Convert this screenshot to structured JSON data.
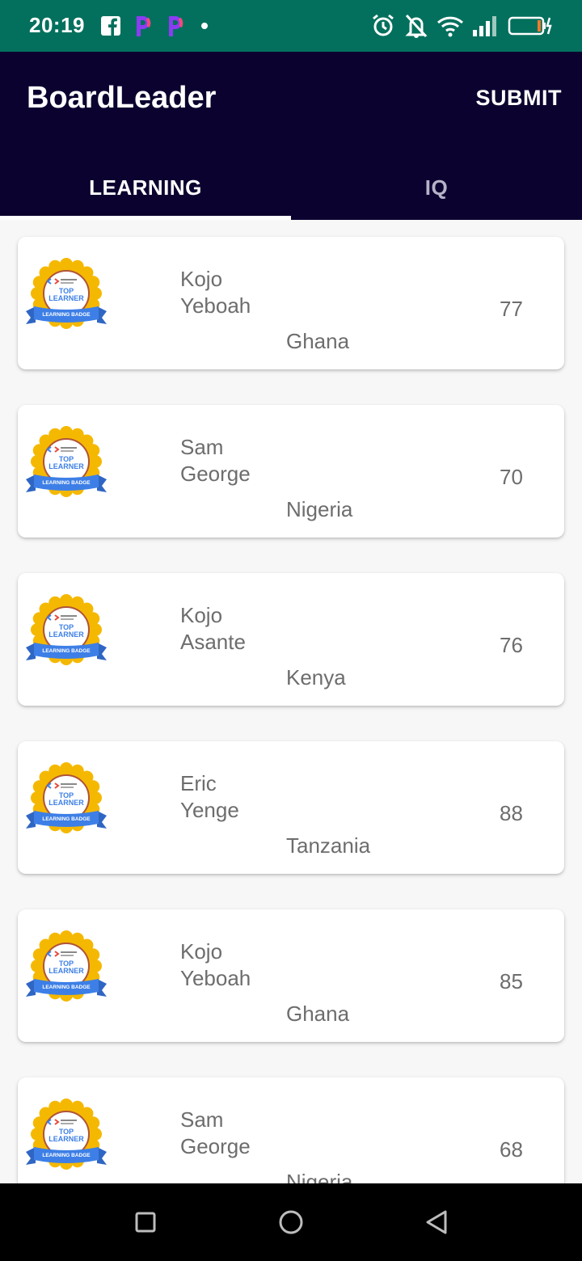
{
  "status_bar": {
    "time": "20:19"
  },
  "app_bar": {
    "title": "BoardLeader",
    "submit_label": "SUBMIT"
  },
  "tabs": [
    {
      "label": "LEARNING",
      "active": true
    },
    {
      "label": "IQ",
      "active": false
    }
  ],
  "badge": {
    "line1": "TOP",
    "line2": "LEARNER",
    "ribbon": "LEARNING BADGE"
  },
  "learners": [
    {
      "first": "Kojo",
      "last": "Yeboah",
      "country": "Ghana",
      "score": "77"
    },
    {
      "first": "Sam",
      "last": "George",
      "country": "Nigeria",
      "score": "70"
    },
    {
      "first": "Kojo",
      "last": "Asante",
      "country": "Kenya",
      "score": "76"
    },
    {
      "first": "Eric",
      "last": "Yenge",
      "country": "Tanzania",
      "score": "88"
    },
    {
      "first": "Kojo",
      "last": "Yeboah",
      "country": "Ghana",
      "score": "85"
    },
    {
      "first": "Sam",
      "last": "George",
      "country": "Nigeria",
      "score": "68"
    }
  ],
  "colors": {
    "status_bar": "#02705d",
    "app_bar": "#0c0230",
    "badge_gold": "#f5b800",
    "badge_blue": "#3d7fe6"
  }
}
